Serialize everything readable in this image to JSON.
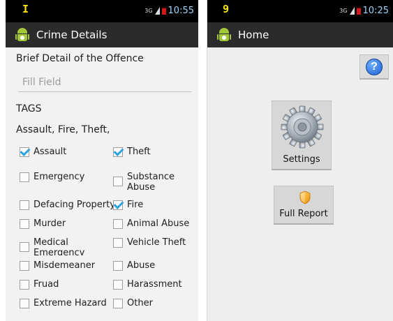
{
  "left_screen": {
    "status": {
      "indicator": "I",
      "network": "3G",
      "time": "10:55"
    },
    "actionbar": {
      "title": "Crime Details",
      "icon": "android-icon"
    },
    "brief_label": "Brief Detail of the Offence",
    "fill_field": {
      "placeholder": "Fill Field",
      "value": ""
    },
    "tags_label": "TAGS",
    "tags_value": "Assault, Fire, Theft,",
    "checkboxes": [
      {
        "label": "Assault",
        "checked": true
      },
      {
        "label": "Theft",
        "checked": true
      },
      {
        "label": "Emergency",
        "checked": false
      },
      {
        "label": "Substance Abuse",
        "checked": false
      },
      {
        "label": "Defacing Property",
        "checked": false
      },
      {
        "label": "Fire",
        "checked": true
      },
      {
        "label": "Murder",
        "checked": false
      },
      {
        "label": "Animal Abuse",
        "checked": false
      },
      {
        "label": "Medical Emergency",
        "checked": false
      },
      {
        "label": "Vehicle Theft",
        "checked": false
      },
      {
        "label": "Misdemeaner",
        "checked": false
      },
      {
        "label": "Abuse",
        "checked": false
      },
      {
        "label": "Fruad",
        "checked": false
      },
      {
        "label": "Harassment",
        "checked": false
      },
      {
        "label": "Extreme Hazard",
        "checked": false
      },
      {
        "label": "Other",
        "checked": false
      }
    ]
  },
  "right_screen": {
    "status": {
      "indicator": "9",
      "network": "3G",
      "time": "10:25"
    },
    "actionbar": {
      "title": "Home",
      "icon": "android-icon"
    },
    "help_button": {
      "label": "?",
      "icon": "help-icon"
    },
    "settings_tile": {
      "label": "Settings",
      "icon": "gear-icon"
    },
    "report_tile": {
      "label": "Full Report",
      "icon": "shield-icon"
    }
  },
  "colors": {
    "action_bar": "#2b2b2b",
    "status_bar": "#000000",
    "status_indicator": "#f5e600",
    "check": "#2ea3df",
    "android_green": "#a4c639"
  }
}
